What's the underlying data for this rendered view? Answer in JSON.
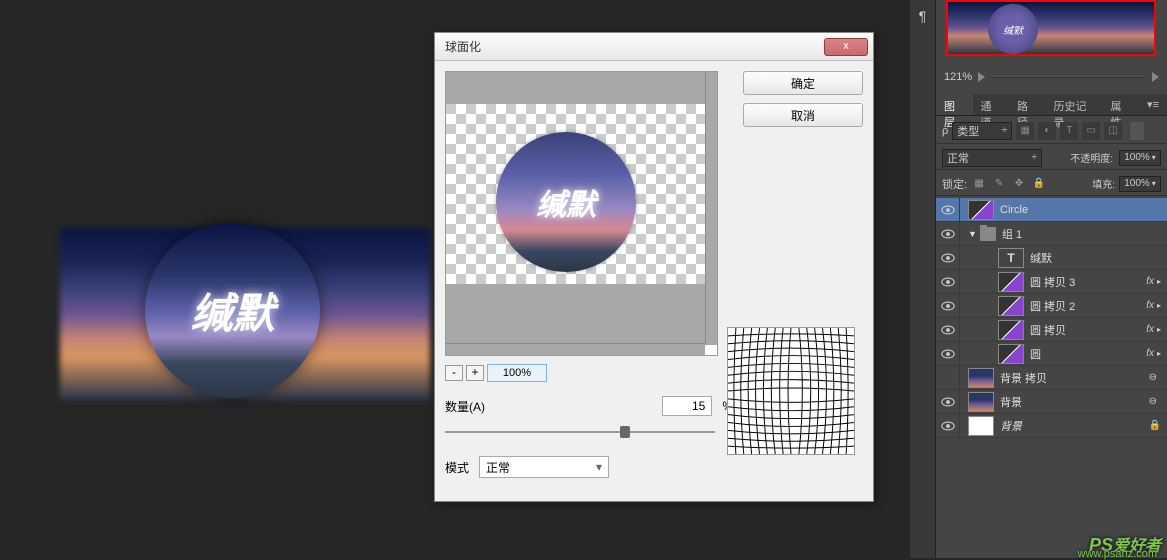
{
  "dialog": {
    "title": "球面化",
    "ok": "确定",
    "cancel": "取消",
    "zoom_minus": "-",
    "zoom_plus": "+",
    "zoom_value": "100%",
    "amount_label": "数量(A)",
    "amount_value": "15",
    "amount_unit": "%",
    "mode_label": "模式",
    "mode_value": "正常",
    "preview_text": "缄默"
  },
  "canvas": {
    "text": "缄默"
  },
  "navigator": {
    "zoom": "121%",
    "thumb_text": "缄默"
  },
  "panel": {
    "tabs": {
      "layers": "图层",
      "channels": "通道",
      "paths": "路径",
      "history": "历史记录",
      "properties": "属性"
    },
    "filter_kind": "类型",
    "blend_mode": "正常",
    "opacity_label": "不透明度:",
    "opacity_value": "100%",
    "lock_label": "锁定:",
    "fill_label": "填充:",
    "fill_value": "100%"
  },
  "layers": [
    {
      "name": "Circle",
      "type": "smartobj",
      "indent": 0,
      "selected": true,
      "fx": false,
      "visible": true
    },
    {
      "name": "组 1",
      "type": "group",
      "indent": 0,
      "selected": false,
      "fx": false,
      "visible": true
    },
    {
      "name": "缄默",
      "type": "text",
      "indent": 2,
      "selected": false,
      "fx": false,
      "visible": true
    },
    {
      "name": "圆 拷贝 3",
      "type": "smartobj",
      "indent": 2,
      "selected": false,
      "fx": true,
      "visible": true
    },
    {
      "name": "圆 拷贝 2",
      "type": "smartobj",
      "indent": 2,
      "selected": false,
      "fx": true,
      "visible": true
    },
    {
      "name": "圆 拷贝",
      "type": "smartobj",
      "indent": 2,
      "selected": false,
      "fx": true,
      "visible": true
    },
    {
      "name": "圆",
      "type": "smartobj",
      "indent": 2,
      "selected": false,
      "fx": true,
      "visible": true
    },
    {
      "name": "背景 拷贝",
      "type": "bg",
      "indent": 0,
      "selected": false,
      "fx": false,
      "visible": false,
      "linked": true
    },
    {
      "name": "背景",
      "type": "bg",
      "indent": 0,
      "selected": false,
      "fx": false,
      "visible": true,
      "linked": true
    },
    {
      "name": "背景",
      "type": "white",
      "indent": 0,
      "selected": false,
      "fx": false,
      "visible": true,
      "locked": true,
      "italic": true
    }
  ],
  "watermark": {
    "brand_en": "PS",
    "brand_zh": "爱好者",
    "url": "www.psahz.com"
  }
}
